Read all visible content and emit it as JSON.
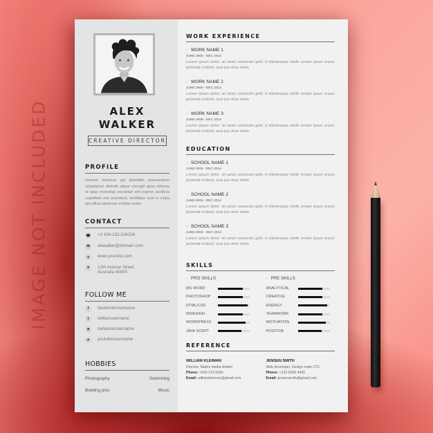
{
  "watermark": "IMAGE NOT INCLUDED",
  "colors": {
    "background": "#f98a80",
    "paper": "#efefef",
    "sidebar": "#e3e4e6",
    "text_dark": "#1b1b1b",
    "bar_fill": "#111111",
    "bar_track": "#d9d9d9"
  },
  "resume": {
    "name_first": "ALEX",
    "name_last": "WALKER",
    "role": "CREATIVE DIRECTOR",
    "profile": {
      "heading": "PROFILE",
      "text": "Issimos ducimus qui blanditiis praesentium voluptatum deleniti atque corrupti quos dolores et quas molestias excepturi sint ocproe suntficia cupiditate non provident, simillique sunt in culpa qui officia deserunt mollitia animi"
    },
    "contact": {
      "heading": "CONTACT",
      "items": [
        {
          "icon": "phone-icon",
          "glyph": "☎",
          "text": "+2 434-232-534234"
        },
        {
          "icon": "mail-icon",
          "glyph": "✉",
          "text": "alxwalker@domain.com"
        },
        {
          "icon": "globe-icon",
          "glyph": "●",
          "text": "www.yoursite.com"
        },
        {
          "icon": "location-pin-icon",
          "glyph": "▼",
          "text": "12th Avenue Street",
          "text2": "Australia 40000"
        }
      ]
    },
    "follow": {
      "heading": "FOLLOW ME",
      "items": [
        {
          "icon": "facebook-icon",
          "glyph": "f",
          "text": "facebook/username"
        },
        {
          "icon": "twitter-icon",
          "glyph": "t",
          "text": "twitter/username"
        },
        {
          "icon": "behance-icon",
          "glyph": "■",
          "text": "behance/username"
        },
        {
          "icon": "youtube-icon",
          "glyph": "▲",
          "text": "youtube/username"
        }
      ]
    },
    "hobbies": {
      "heading": "HOBBIES",
      "rows": [
        [
          "Photography",
          "Swimming"
        ],
        [
          "Bowling pins",
          "Music"
        ]
      ]
    },
    "work": {
      "heading": "WORK EXPERIENCE",
      "entries": [
        {
          "title": "WORK NAME 1",
          "date": "JUNE 2008 - DEC 2014",
          "desc": "Lorem ipsum dolor: sit amet consectet gelit. it ellentesque eleife ornare ipsun enunc pulvinati ncidunt. quis pul vinar mellu"
        },
        {
          "title": "WORK NAME 2",
          "date": "JUNE 2008 - DEC 2014",
          "desc": "Lorem ipsum dolor: sit amet consectet gelit. it ellentesque eleife ornare ipsun enunc pulvinati ncidunt. quis pul vinar mellu"
        },
        {
          "title": "WORK NAME 3",
          "date": "JUNE 2008 - DEC 2014",
          "desc": "Lorem ipsum dolor: sit amet consectet gelit. it ellentesque eleife ornare ipsun enunc pulvinati ncidunt. quis pul vinar mellu"
        }
      ]
    },
    "education": {
      "heading": "EDUCATION",
      "entries": [
        {
          "title": "SCHOOL NAME 1",
          "date": "JUNE 2008 - DEC 2014",
          "desc": "Lorem ipsum dolor: sit amet consectet gelit. it ellentesque eleife ornare ipsun enunc pulvinati ncidunt. quis pul vinar mellu"
        },
        {
          "title": "SCHOOL NAME 2",
          "date": "JUNE 2008 - DEC 2014",
          "desc": "Lorem ipsum dolor: sit amet consectet gelit. it ellentesque eleife ornare ipsun enunc pulvinati ncidunt. quis pul vinar mellu"
        },
        {
          "title": "SCHOOL NAME 3",
          "date": "JUNE 2008 - DEC 2014",
          "desc": "Lorem ipsum dolor: sit amet consectet gelit. it ellentesque eleife ornare ipsun enunc pulvinati ncidunt. quis pul vinar mellu"
        }
      ]
    },
    "skills": {
      "heading": "SKILLS",
      "pro": {
        "label": "PRO SKILLS",
        "items": [
          {
            "name": "MS WORD",
            "level": 0.78
          },
          {
            "name": "PHOTOSHOP",
            "level": 0.78
          },
          {
            "name": "HTML/CSS",
            "level": 0.93
          },
          {
            "name": "INDESIGN",
            "level": 0.78
          },
          {
            "name": "WORDPRESS",
            "level": 0.88
          },
          {
            "name": "JAVA SCRPT",
            "level": 0.74
          }
        ]
      },
      "pre": {
        "label": "PRE  SKILLS",
        "items": [
          {
            "name": "ANALYTICAL",
            "level": 0.78
          },
          {
            "name": "CREATIVE",
            "level": 0.78
          },
          {
            "name": "ENERGY",
            "level": 0.93
          },
          {
            "name": "TEAMWORK",
            "level": 0.78
          },
          {
            "name": "MOTIVATION",
            "level": 0.88
          },
          {
            "name": "POSITIVE",
            "level": 0.74
          }
        ]
      }
    },
    "reference": {
      "heading": "REFERENCE",
      "people": [
        {
          "name": "WILLIAM KLEIMAN",
          "title": "Director, Matrix media limited",
          "phone_label": "Phone:",
          "phone": "+555 123 5566",
          "email_label": "Email:",
          "email": "williamkleiman@gmail.com"
        },
        {
          "name": "JENSEN SMITH",
          "title": "Web developer, Design mate LTD",
          "phone_label": "Phone:",
          "phone": "+123 5556 4455",
          "email_label": "Email:",
          "email": "jensonsmith@gmail.com"
        }
      ]
    }
  }
}
